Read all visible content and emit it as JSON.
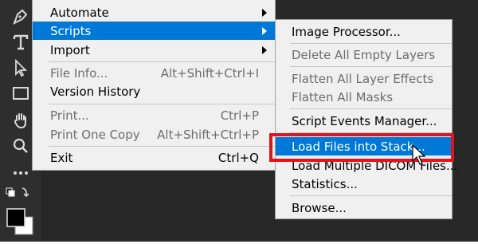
{
  "main_menu": {
    "items": [
      {
        "label": "Automate",
        "shortcut": "",
        "has_submenu": true
      },
      {
        "label": "Scripts",
        "shortcut": "",
        "has_submenu": true
      },
      {
        "label": "Import",
        "shortcut": "",
        "has_submenu": true
      },
      {
        "label": "File Info...",
        "shortcut": "Alt+Shift+Ctrl+I"
      },
      {
        "label": "Version History",
        "shortcut": ""
      },
      {
        "label": "Print...",
        "shortcut": "Ctrl+P"
      },
      {
        "label": "Print One Copy",
        "shortcut": "Alt+Shift+Ctrl+P"
      },
      {
        "label": "Exit",
        "shortcut": "Ctrl+Q"
      }
    ]
  },
  "scripts_submenu": {
    "items": [
      {
        "label": "Image Processor..."
      },
      {
        "label": "Delete All Empty Layers"
      },
      {
        "label": "Flatten All Layer Effects"
      },
      {
        "label": "Flatten All Masks"
      },
      {
        "label": "Script Events Manager..."
      },
      {
        "label": "Load Files into Stack..."
      },
      {
        "label": "Load Multiple DICOM Files..."
      },
      {
        "label": "Statistics..."
      },
      {
        "label": "Browse..."
      }
    ]
  },
  "colors": {
    "menu_bg": "#f0f0f0",
    "selection": "#0078d7",
    "callout_border": "#e0141e",
    "toolbar_bg": "#2e2e2e",
    "disabled_text": "#6d6d6d"
  },
  "toolbar": {
    "tools": [
      "pen-icon",
      "type-icon",
      "path-selection-icon",
      "rectangle-icon",
      "hand-icon",
      "zoom-icon",
      "more-tools-icon",
      "swap-colors-icon",
      "color-swatches-icon"
    ]
  }
}
